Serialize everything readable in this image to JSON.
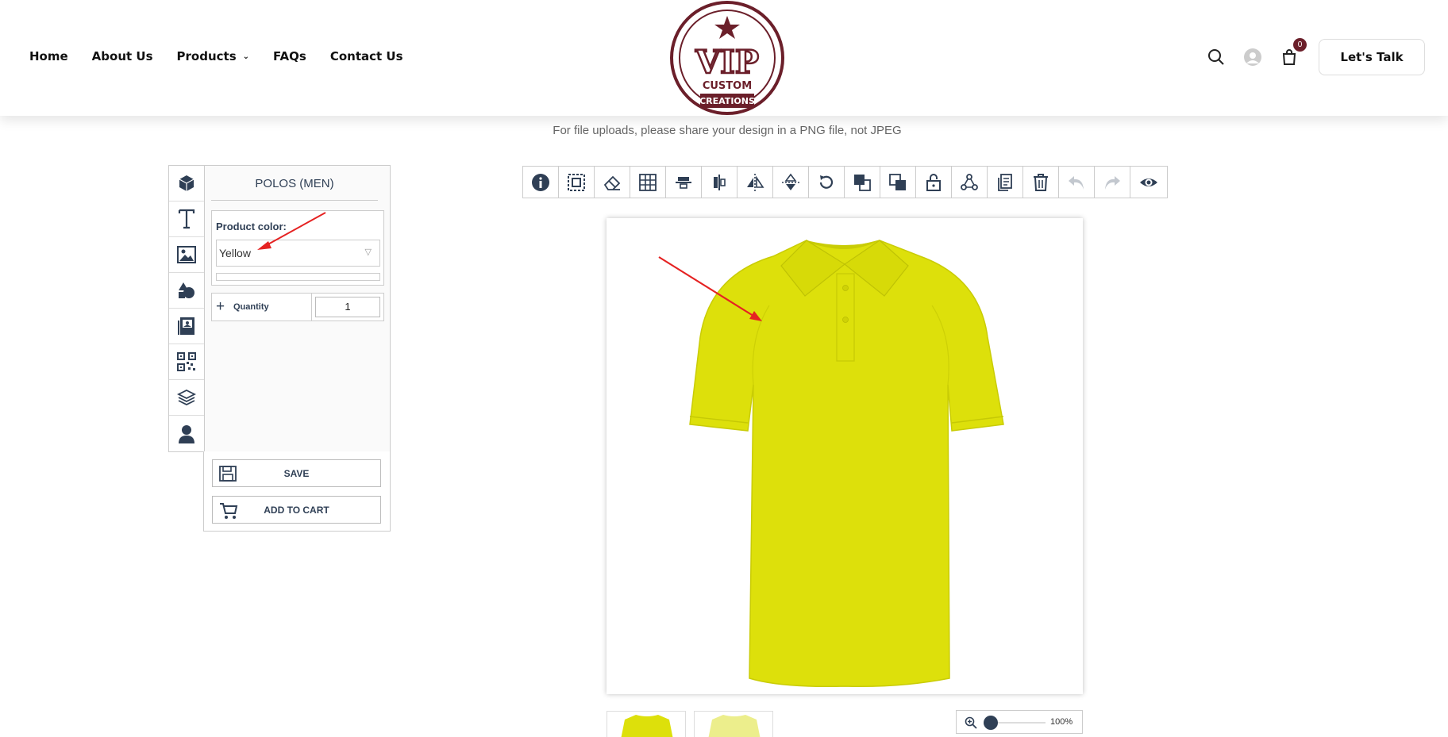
{
  "nav": {
    "home": "Home",
    "about": "About Us",
    "products": "Products",
    "faqs": "FAQs",
    "contact": "Contact Us"
  },
  "logo": {
    "main": "VIP",
    "line1": "CUSTOM",
    "line2": "CREATIONS"
  },
  "header": {
    "cart_count": "0",
    "cta": "Let's Talk"
  },
  "notice": "For file uploads, please share your design in a PNG file, not JPEG",
  "designer": {
    "product_title": "POLOS (MEN)",
    "color_label": "Product color:",
    "color_value": "Yellow",
    "quantity_label": "Quantity",
    "quantity_value": "1",
    "save_label": "SAVE",
    "add_to_cart_label": "ADD TO CART",
    "zoom_label": "100%",
    "zoom_level_percent": 100
  },
  "sidebar_tools": [
    "product-icon",
    "text-icon",
    "image-icon",
    "shapes-icon",
    "gallery-icon",
    "qrcode-icon",
    "layers-icon",
    "user-icon"
  ],
  "toolbar_tools": [
    "info-icon",
    "select-icon",
    "eraser-icon",
    "grid-icon",
    "align-center-horizontal-icon",
    "align-center-vertical-icon",
    "flip-horizontal-icon",
    "flip-vertical-icon",
    "rotate-icon",
    "bring-forward-icon",
    "send-backward-icon",
    "lock-icon",
    "group-icon",
    "duplicate-icon",
    "delete-icon",
    "undo-icon",
    "redo-icon",
    "preview-icon"
  ],
  "colors": {
    "shirt": "#dde00b",
    "accent": "#2f3f55",
    "brand": "#6b1f2a",
    "annotation": "#e52222"
  }
}
